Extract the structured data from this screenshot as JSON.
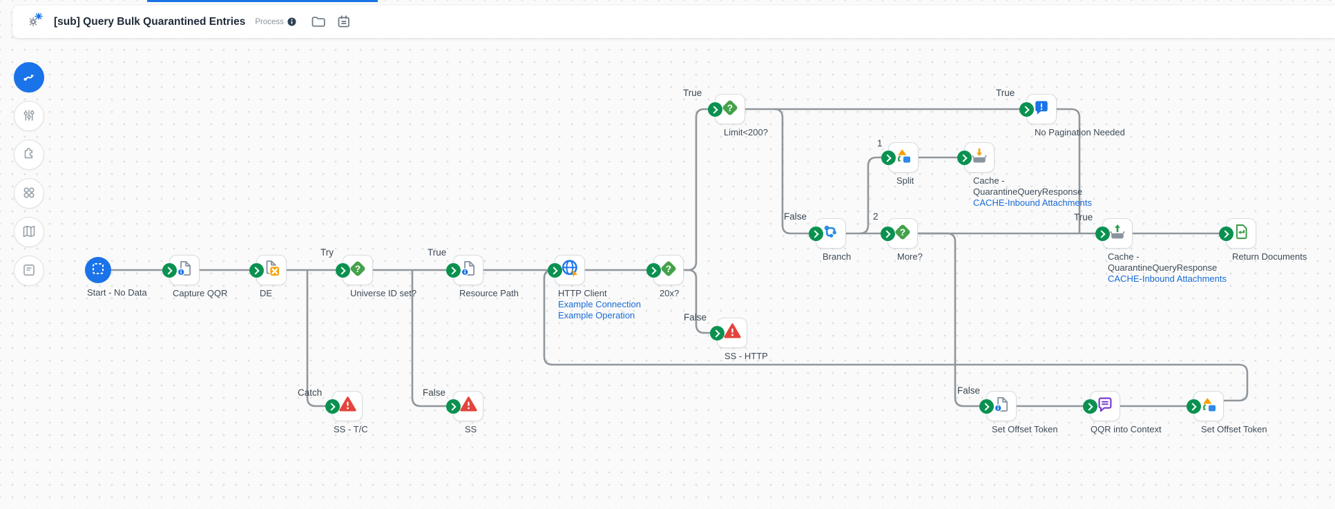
{
  "header": {
    "title": "[sub] Query Bulk Quarantined Entries",
    "type_label": "Process",
    "icons": [
      "process-gears-icon",
      "info-icon",
      "folder-icon",
      "clipboard-icon"
    ]
  },
  "sidebar": {
    "tools": [
      "process-flow",
      "adjustments",
      "extensions",
      "components",
      "map",
      "notes"
    ],
    "active_tool": "process-flow"
  },
  "colors": {
    "accent_blue": "#1a73e8",
    "connector_gray": "#8f969c",
    "chevron_green": "#0a9150",
    "decision_green": "#44a24a",
    "error_red": "#e2453c",
    "orange": "#f7a104",
    "purple": "#7a3bd0",
    "link_blue": "#1769d6"
  },
  "canvas": {
    "nodes": {
      "start": {
        "label": "Start - No Data"
      },
      "capture_qqr": {
        "label": "Capture QQR"
      },
      "de": {
        "label": "DE"
      },
      "universe_id_set": {
        "label": "Universe ID set?"
      },
      "resource_path": {
        "label": "Resource Path"
      },
      "http_client": {
        "label": "HTTP Client",
        "link1": "Example Connection",
        "link2": "Example Operation"
      },
      "x20": {
        "label": "20x?"
      },
      "limit": {
        "label": "Limit<200?"
      },
      "ss_http": {
        "label": "SS - HTTP"
      },
      "branch": {
        "label": "Branch"
      },
      "split": {
        "label": "Split"
      },
      "cache_store": {
        "line1": "Cache -",
        "line2": "QuarantineQueryResponse",
        "link": "CACHE-Inbound Attachments"
      },
      "more": {
        "label": "More?"
      },
      "no_pagination": {
        "label": "No Pagination Needed"
      },
      "cache_retrieve": {
        "line1": "Cache -",
        "line2": "QuarantineQueryResponse",
        "link": "CACHE-Inbound Attachments"
      },
      "return_documents": {
        "label": "Return Documents"
      },
      "ss_tc": {
        "label": "SS - T/C"
      },
      "ss": {
        "label": "SS"
      },
      "set_offset_1": {
        "label": "Set Offset Token"
      },
      "qqr_into_context": {
        "label": "QQR into Context"
      },
      "set_offset_2": {
        "label": "Set Offset Token"
      }
    },
    "edges": {
      "try": "Try",
      "catch": "Catch",
      "universe_true": "True",
      "universe_false": "False",
      "x20_true": "True",
      "x20_false": "False",
      "limit_true": "True",
      "limit_false": "False",
      "branch_1": "1",
      "branch_2": "2",
      "more_true": "True",
      "more_false": "False"
    }
  }
}
